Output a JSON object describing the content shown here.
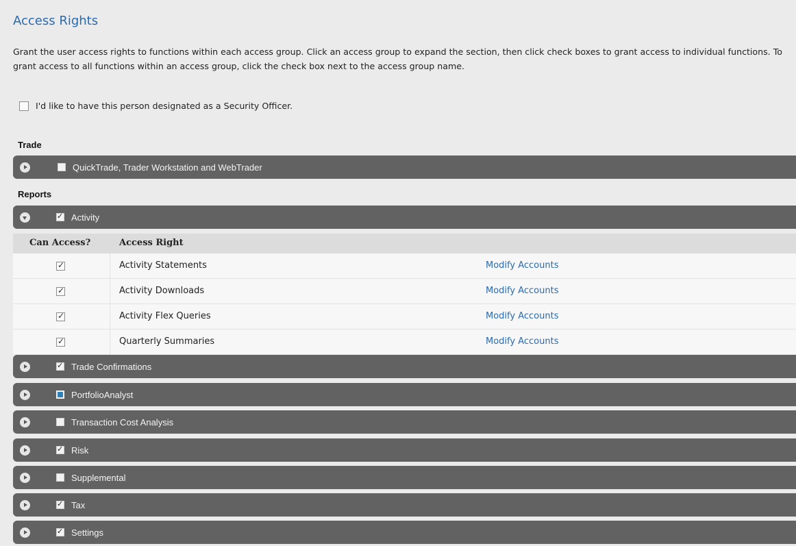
{
  "title": "Access Rights",
  "intro": "Grant the user access rights to functions within each access group. Click an access group to expand the section, then click check boxes to grant access to individual functions. To grant access to all functions within an access group, click the check box next to the access group name.",
  "security_officer": {
    "label": "I'd like to have this person designated as a Security Officer.",
    "checked": false
  },
  "sections": {
    "trade": "Trade",
    "reports": "Reports"
  },
  "groups": [
    {
      "label": "QuickTrade, Trader Workstation and WebTrader",
      "state": "unchecked",
      "expanded": false
    },
    {
      "label": "Activity",
      "state": "checked",
      "expanded": true
    },
    {
      "label": "Trade Confirmations",
      "state": "checked",
      "expanded": false
    },
    {
      "label": "PortfolioAnalyst",
      "state": "partial",
      "expanded": false
    },
    {
      "label": "Transaction Cost Analysis",
      "state": "unchecked",
      "expanded": false
    },
    {
      "label": "Risk",
      "state": "checked",
      "expanded": false
    },
    {
      "label": "Supplemental",
      "state": "unchecked",
      "expanded": false
    },
    {
      "label": "Tax",
      "state": "checked",
      "expanded": false
    },
    {
      "label": "Settings",
      "state": "checked",
      "expanded": false
    }
  ],
  "activity_table": {
    "headers": [
      "Can Access?",
      "Access Right"
    ],
    "rows": [
      {
        "name": "Activity Statements",
        "checked": true,
        "link": "Modify Accounts"
      },
      {
        "name": "Activity Downloads",
        "checked": true,
        "link": "Modify Accounts"
      },
      {
        "name": "Activity Flex Queries",
        "checked": true,
        "link": "Modify Accounts"
      },
      {
        "name": "Quarterly Summaries",
        "checked": true,
        "link": "Modify Accounts"
      }
    ]
  },
  "colors": {
    "bar": "#626262",
    "title": "#2a6bb0",
    "link": "#2a6bb0",
    "partial": "#2f7fb8"
  }
}
